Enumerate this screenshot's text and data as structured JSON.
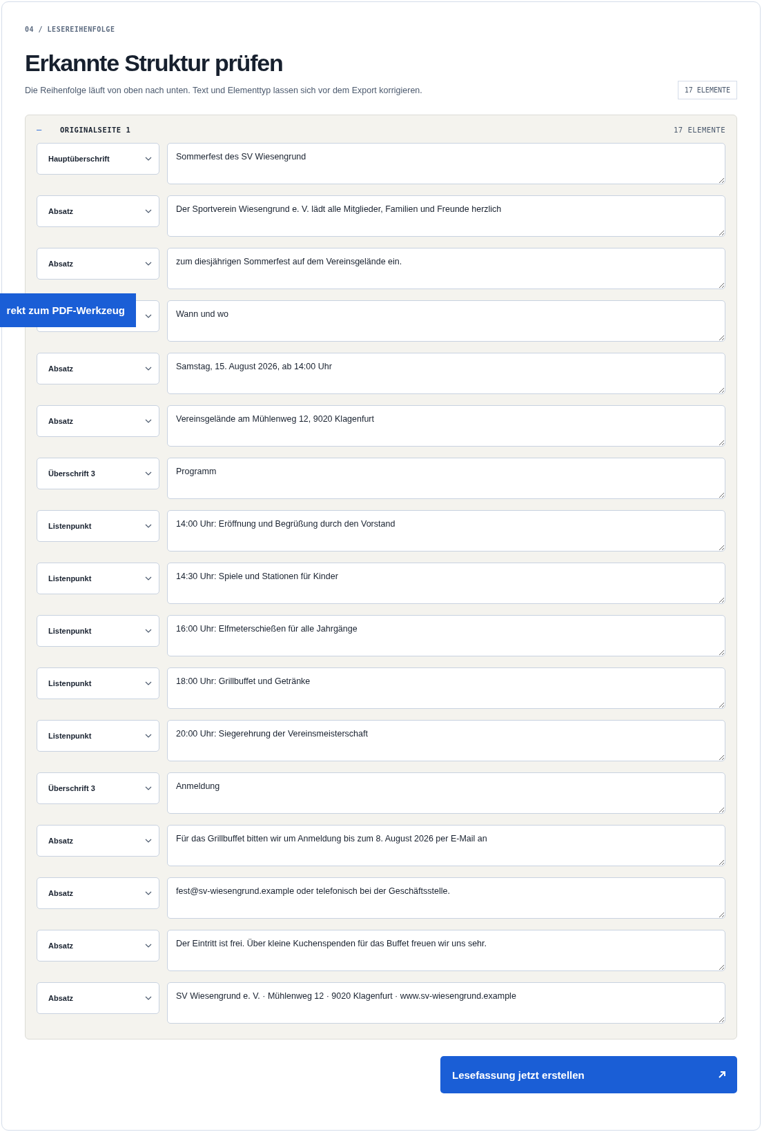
{
  "eyebrow": "04 / LESEREIHENFOLGE",
  "title": "Erkannte Struktur prüfen",
  "subtitle": "Die Reihenfolge läuft von oben nach unten. Text und Elementtyp lassen sich vor dem Export korrigieren.",
  "count_badge": "17 ELEMENTE",
  "skip_link": "rekt zum PDF-Werkzeug",
  "page_group": {
    "toggle": "–",
    "title": "ORIGINALSEITE 1",
    "count": "17 ELEMENTE",
    "rows": [
      {
        "type": "Hauptüberschrift",
        "text": "Sommerfest des SV Wiesengrund"
      },
      {
        "type": "Absatz",
        "text": "Der Sportverein Wiesengrund e. V. lädt alle Mitglieder, Familien und Freunde herzlich"
      },
      {
        "type": "Absatz",
        "text": "zum diesjährigen Sommerfest auf dem Vereinsgelände ein."
      },
      {
        "text": "Wann und wo"
      },
      {
        "type": "Absatz",
        "text": "Samstag, 15. August 2026, ab 14:00 Uhr"
      },
      {
        "type": "Absatz",
        "text": "Vereinsgelände am Mühlenweg 12, 9020 Klagenfurt"
      },
      {
        "type": "Überschrift 3",
        "text": "Programm"
      },
      {
        "type": "Listenpunkt",
        "text": "14:00 Uhr: Eröffnung und Begrüßung durch den Vorstand"
      },
      {
        "type": "Listenpunkt",
        "text": "14:30 Uhr: Spiele und Stationen für Kinder"
      },
      {
        "type": "Listenpunkt",
        "text": "16:00 Uhr: Elfmeterschießen für alle Jahrgänge"
      },
      {
        "type": "Listenpunkt",
        "text": "18:00 Uhr: Grillbuffet und Getränke"
      },
      {
        "type": "Listenpunkt",
        "text": "20:00 Uhr: Siegerehrung der Vereinsmeisterschaft"
      },
      {
        "type": "Überschrift 3",
        "text": "Anmeldung"
      },
      {
        "type": "Absatz",
        "text": "Für das Grillbuffet bitten wir um Anmeldung bis zum 8. August 2026 per E-Mail an"
      },
      {
        "type": "Absatz",
        "text": "fest@sv-wiesengrund.example oder telefonisch bei der Geschäftsstelle."
      },
      {
        "type": "Absatz",
        "text": "Der Eintritt ist frei. Über kleine Kuchenspenden für das Buffet freuen wir uns sehr."
      },
      {
        "type": "Absatz",
        "text": "SV Wiesengrund e. V. · Mühlenweg 12 · 9020 Klagenfurt · www.sv-wiesengrund.example"
      }
    ]
  },
  "submit": "Lesefassung jetzt erstellen"
}
